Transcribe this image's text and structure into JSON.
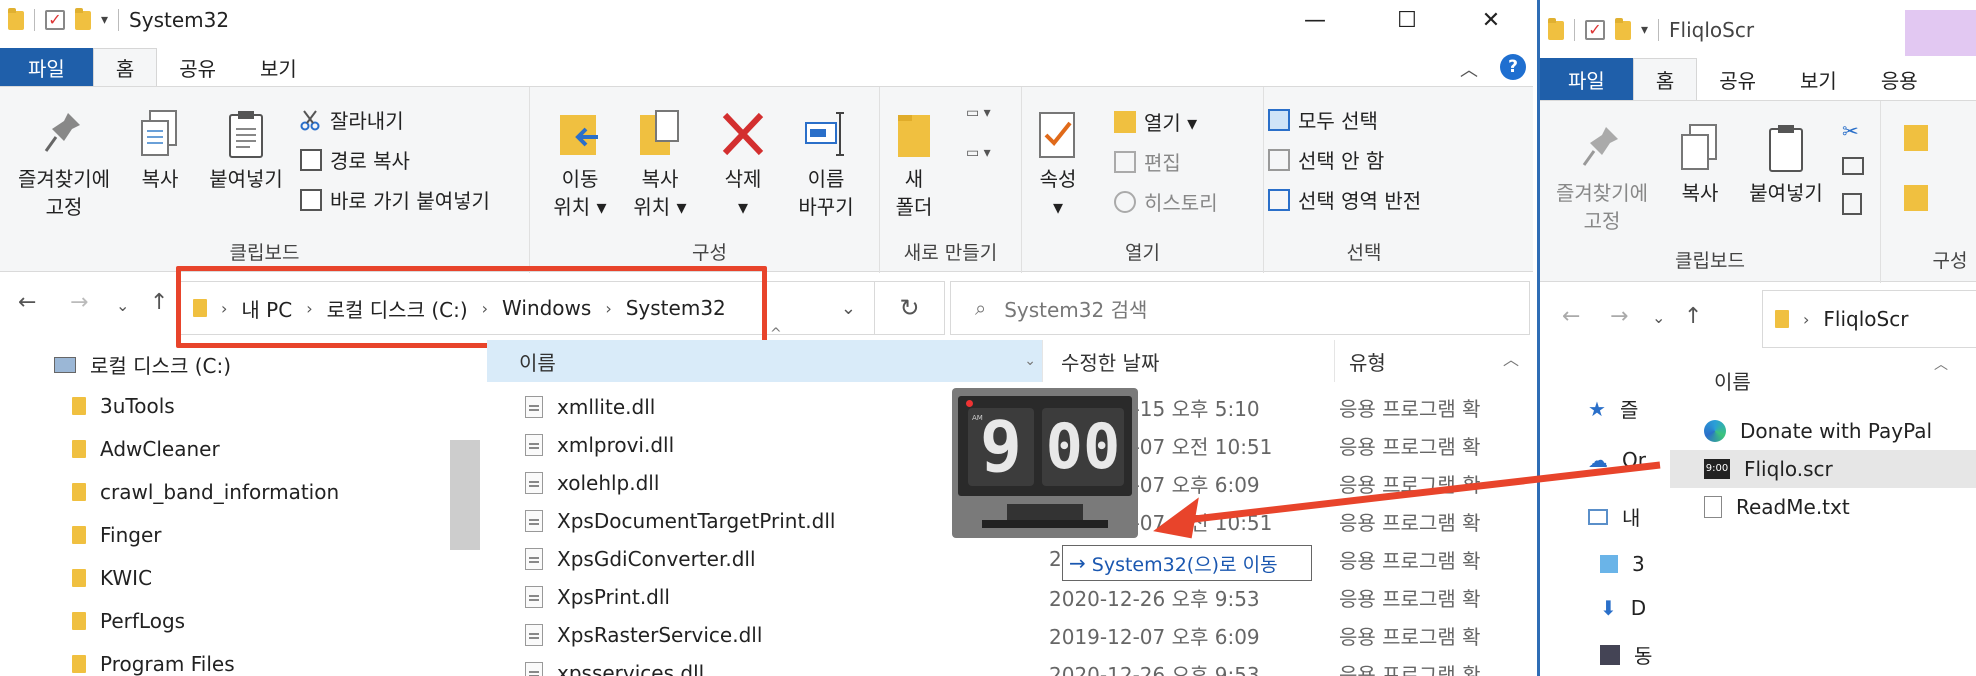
{
  "win1": {
    "title": "System32",
    "controls": {
      "minimize": "—",
      "maximize": "☐",
      "close": "✕"
    },
    "tabs": {
      "file": "파일",
      "home": "홈",
      "share": "공유",
      "view": "보기"
    },
    "ribbon": {
      "pin_line1": "즐겨찾기에",
      "pin_line2": "고정",
      "copy": "복사",
      "paste": "붙여넣기",
      "cut": "잘라내기",
      "copy_path": "경로 복사",
      "paste_shortcut": "바로 가기 붙여넣기",
      "clipboard_group": "클립보드",
      "move_line1": "이동",
      "move_line2": "위치 ▾",
      "copyto_line1": "복사",
      "copyto_line2": "위치 ▾",
      "delete_line1": "삭제",
      "delete_line2": "▾",
      "rename_line1": "이름",
      "rename_line2": "바꾸기",
      "organize_group": "구성",
      "newfolder_line1": "새",
      "newfolder_line2": "폴더",
      "new_group": "새로 만들기",
      "props_line1": "속성",
      "props_line2": "▾",
      "open": "열기 ▾",
      "edit": "편집",
      "history": "히스토리",
      "open_group": "열기",
      "select_all": "모두 선택",
      "select_none": "선택 안 함",
      "invert": "선택 영역 반전",
      "select_group": "선택"
    },
    "address": {
      "crumbs": [
        "내 PC",
        "로컬 디스크 (C:)",
        "Windows",
        "System32"
      ]
    },
    "search_placeholder": "System32 검색",
    "nav": [
      "로컬 디스크 (C:)",
      "3uTools",
      "AdwCleaner",
      "crawl_band_information",
      "Finger",
      "KWIC",
      "PerfLogs",
      "Program Files"
    ],
    "columns": {
      "name": "이름",
      "date": "수정한 날짜",
      "type": "유형"
    },
    "files": [
      {
        "name": "xmllite.dll",
        "date": "2020-10-15 오후 5:10",
        "type": "응용 프로그램 확"
      },
      {
        "name": "xmlprovi.dll",
        "date": "2019-12-07 오전 10:51",
        "type": "응용 프로그램 확"
      },
      {
        "name": "xolehlp.dll",
        "date": "2019-12-07 오후 6:09",
        "type": "응용 프로그램 확"
      },
      {
        "name": "XpsDocumentTargetPrint.dll",
        "date": "2021-02-07 오전 10:51",
        "type": "응용 프로그램 확"
      },
      {
        "name": "XpsGdiConverter.dll",
        "date": "2",
        "type": "응용 프로그램 확"
      },
      {
        "name": "XpsPrint.dll",
        "date": "2020-12-26 오후 9:53",
        "type": "응용 프로그램 확"
      },
      {
        "name": "XpsRasterService.dll",
        "date": "2019-12-07 오후 6:09",
        "type": "응용 프로그램 확"
      },
      {
        "name": "xpsservices.dll",
        "date": "2020-12-26 오후 9:53",
        "type": "응용 프로그램 확"
      }
    ],
    "drag_tooltip": "System32(으)로 이동",
    "clock": {
      "ampm": "AM",
      "hour": "9",
      "minutes": "00"
    }
  },
  "win2": {
    "title": "FliqloScr",
    "tabs": {
      "file": "파일",
      "home": "홈",
      "share": "공유",
      "view": "보기",
      "app": "응용"
    },
    "ribbon": {
      "pin_line1": "즐겨찾기에",
      "pin_line2": "고정",
      "copy": "복사",
      "paste": "붙여넣기",
      "clipboard_group": "클립보드",
      "organize_group": "구성"
    },
    "address": "FliqloScr",
    "column_name": "이름",
    "nav": [
      "즐",
      "Or",
      "내",
      "3",
      "D",
      "동"
    ],
    "files": [
      {
        "name": "Donate with PayPal",
        "icon": "edge-icon"
      },
      {
        "name": "Fliqlo.scr",
        "icon": "fliqlo-icon",
        "selected": true
      },
      {
        "name": "ReadMe.txt",
        "icon": "text-file-icon"
      }
    ]
  },
  "colors": {
    "accent": "#1f5faa",
    "highlight": "#e8442b"
  }
}
